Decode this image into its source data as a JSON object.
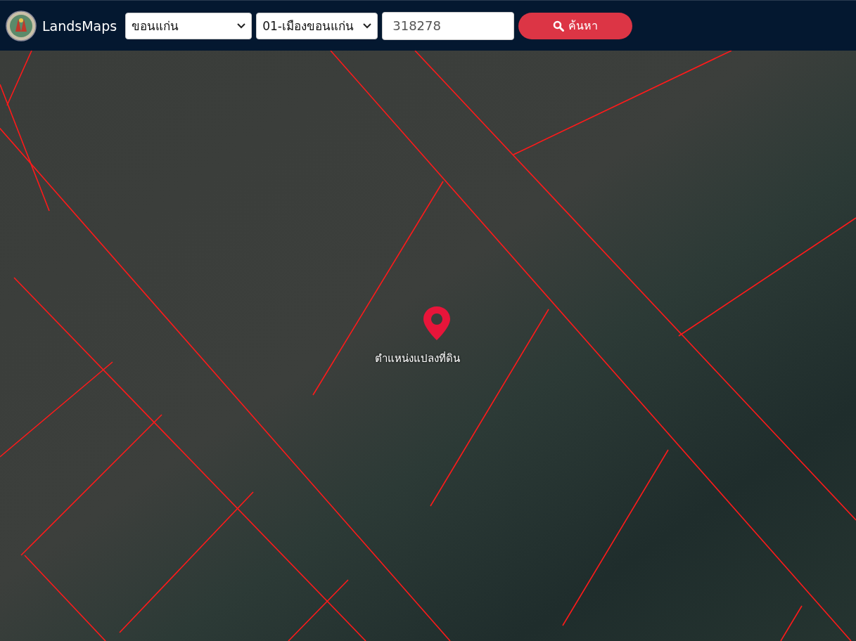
{
  "navbar": {
    "brand": "LandsMaps",
    "province": {
      "value": "ขอนแก่น"
    },
    "district": {
      "value": "01-เมืองขอนแก่น"
    },
    "parcel_number": {
      "value": "318278"
    },
    "search_button": {
      "label": "ค้นหา"
    }
  },
  "map": {
    "marker": {
      "label": "ตำแหน่งแปลงที่ดิน"
    }
  }
}
